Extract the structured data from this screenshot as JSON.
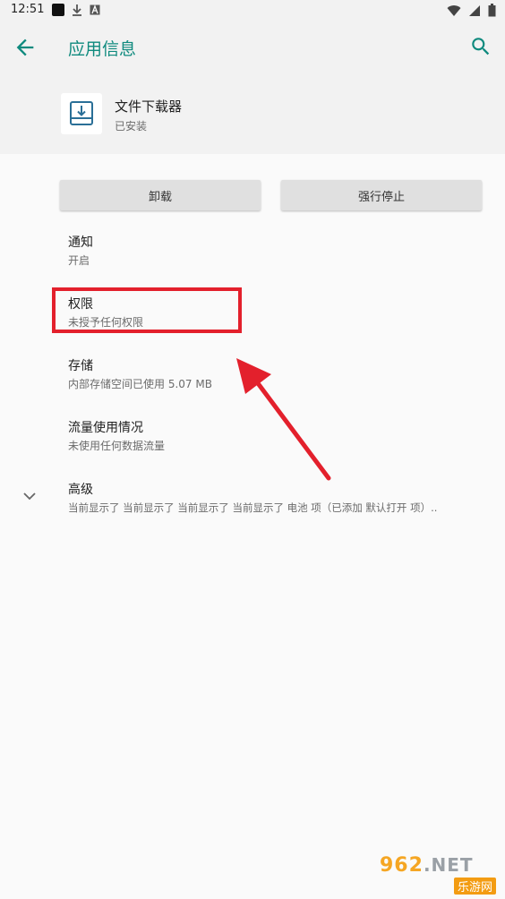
{
  "status_bar": {
    "time": "12:51"
  },
  "app_bar": {
    "title": "应用信息"
  },
  "app": {
    "name": "文件下载器",
    "status": "已安装"
  },
  "buttons": {
    "uninstall": "卸载",
    "force_stop": "强行停止"
  },
  "items": [
    {
      "title": "通知",
      "subtitle": "开启"
    },
    {
      "title": "权限",
      "subtitle": "未授予任何权限"
    },
    {
      "title": "存储",
      "subtitle": "内部存储空间已使用 5.07 MB"
    },
    {
      "title": "流量使用情况",
      "subtitle": "未使用任何数据流量"
    },
    {
      "title": "高级",
      "subtitle": "当前显示了 当前显示了 当前显示了 当前显示了 电池 项（已添加 默认打开 项）.."
    }
  ],
  "watermark": {
    "top": "962",
    "net": ".NET",
    "bottom": "乐游网"
  },
  "colors": {
    "accent": "#0f8a7e",
    "highlight": "#e3202c",
    "header_bg": "#f2f2f2",
    "page_bg": "#fafafa"
  },
  "icons": {
    "back": "arrow-back-icon",
    "search": "search-icon",
    "app": "download-icon",
    "expand": "chevron-down-icon"
  }
}
